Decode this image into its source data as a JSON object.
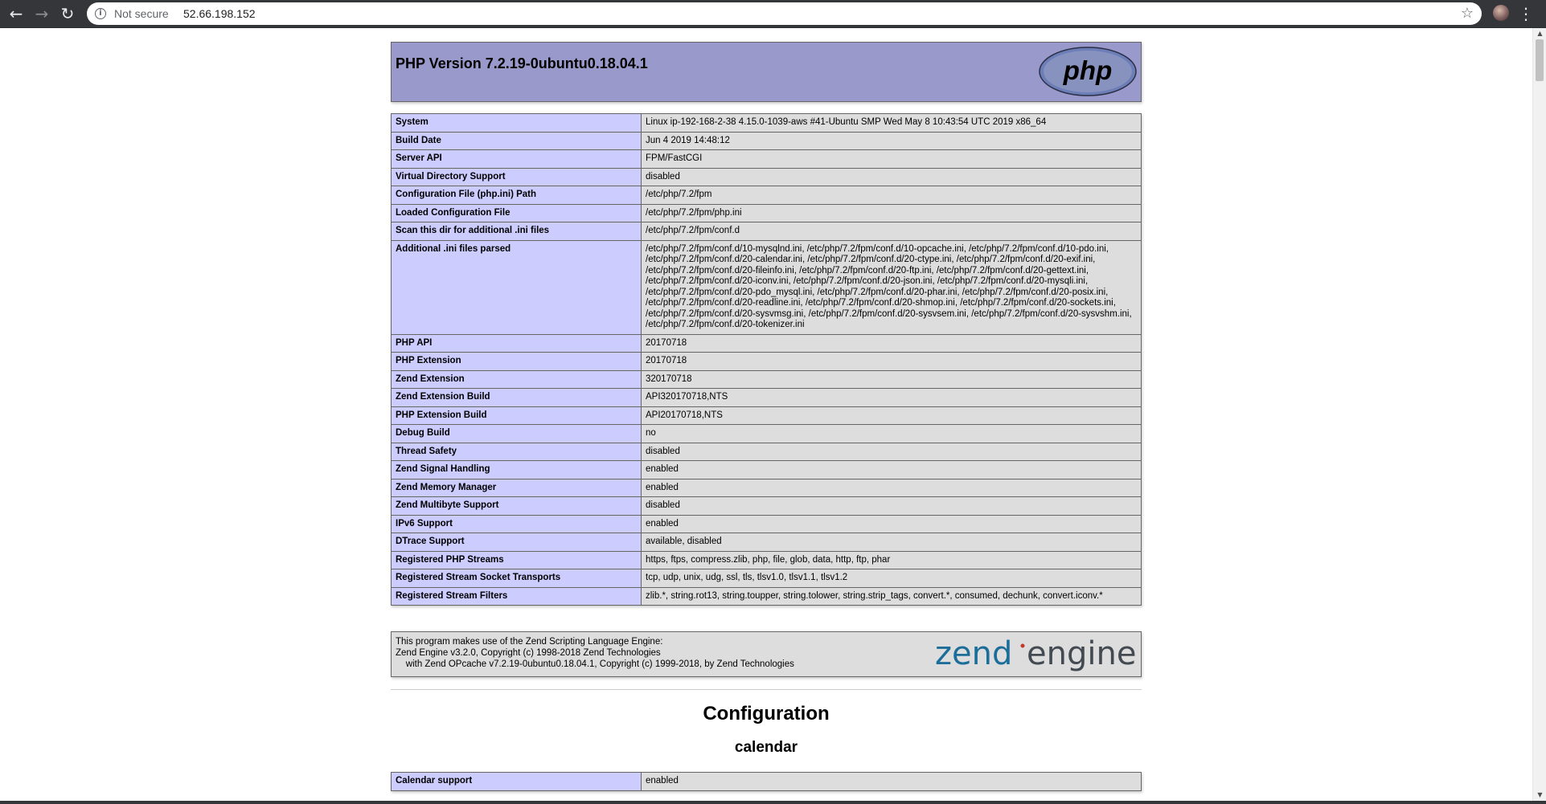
{
  "browser": {
    "security_label": "Not secure",
    "url": "52.66.198.152"
  },
  "header": {
    "title": "PHP Version 7.2.19-0ubuntu0.18.04.1",
    "logo_text": "php"
  },
  "info_table": [
    {
      "key": "System",
      "value": "Linux ip-192-168-2-38 4.15.0-1039-aws #41-Ubuntu SMP Wed May 8 10:43:54 UTC 2019 x86_64"
    },
    {
      "key": "Build Date",
      "value": "Jun 4 2019 14:48:12"
    },
    {
      "key": "Server API",
      "value": "FPM/FastCGI"
    },
    {
      "key": "Virtual Directory Support",
      "value": "disabled"
    },
    {
      "key": "Configuration File (php.ini) Path",
      "value": "/etc/php/7.2/fpm"
    },
    {
      "key": "Loaded Configuration File",
      "value": "/etc/php/7.2/fpm/php.ini"
    },
    {
      "key": "Scan this dir for additional .ini files",
      "value": "/etc/php/7.2/fpm/conf.d"
    },
    {
      "key": "Additional .ini files parsed",
      "value": "/etc/php/7.2/fpm/conf.d/10-mysqlnd.ini, /etc/php/7.2/fpm/conf.d/10-opcache.ini, /etc/php/7.2/fpm/conf.d/10-pdo.ini, /etc/php/7.2/fpm/conf.d/20-calendar.ini, /etc/php/7.2/fpm/conf.d/20-ctype.ini, /etc/php/7.2/fpm/conf.d/20-exif.ini, /etc/php/7.2/fpm/conf.d/20-fileinfo.ini, /etc/php/7.2/fpm/conf.d/20-ftp.ini, /etc/php/7.2/fpm/conf.d/20-gettext.ini, /etc/php/7.2/fpm/conf.d/20-iconv.ini, /etc/php/7.2/fpm/conf.d/20-json.ini, /etc/php/7.2/fpm/conf.d/20-mysqli.ini, /etc/php/7.2/fpm/conf.d/20-pdo_mysql.ini, /etc/php/7.2/fpm/conf.d/20-phar.ini, /etc/php/7.2/fpm/conf.d/20-posix.ini, /etc/php/7.2/fpm/conf.d/20-readline.ini, /etc/php/7.2/fpm/conf.d/20-shmop.ini, /etc/php/7.2/fpm/conf.d/20-sockets.ini, /etc/php/7.2/fpm/conf.d/20-sysvmsg.ini, /etc/php/7.2/fpm/conf.d/20-sysvsem.ini, /etc/php/7.2/fpm/conf.d/20-sysvshm.ini, /etc/php/7.2/fpm/conf.d/20-tokenizer.ini"
    },
    {
      "key": "PHP API",
      "value": "20170718"
    },
    {
      "key": "PHP Extension",
      "value": "20170718"
    },
    {
      "key": "Zend Extension",
      "value": "320170718"
    },
    {
      "key": "Zend Extension Build",
      "value": "API320170718,NTS"
    },
    {
      "key": "PHP Extension Build",
      "value": "API20170718,NTS"
    },
    {
      "key": "Debug Build",
      "value": "no"
    },
    {
      "key": "Thread Safety",
      "value": "disabled"
    },
    {
      "key": "Zend Signal Handling",
      "value": "enabled"
    },
    {
      "key": "Zend Memory Manager",
      "value": "enabled"
    },
    {
      "key": "Zend Multibyte Support",
      "value": "disabled"
    },
    {
      "key": "IPv6 Support",
      "value": "enabled"
    },
    {
      "key": "DTrace Support",
      "value": "available, disabled"
    },
    {
      "key": "Registered PHP Streams",
      "value": "https, ftps, compress.zlib, php, file, glob, data, http, ftp, phar"
    },
    {
      "key": "Registered Stream Socket Transports",
      "value": "tcp, udp, unix, udg, ssl, tls, tlsv1.0, tlsv1.1, tlsv1.2"
    },
    {
      "key": "Registered Stream Filters",
      "value": "zlib.*, string.rot13, string.toupper, string.tolower, string.strip_tags, convert.*, consumed, dechunk, convert.iconv.*"
    }
  ],
  "zend": {
    "line1": "This program makes use of the Zend Scripting Language Engine:",
    "line2": "Zend Engine v3.2.0, Copyright (c) 1998-2018 Zend Technologies",
    "line3": "    with Zend OPcache v7.2.19-0ubuntu0.18.04.1, Copyright (c) 1999-2018, by Zend Technologies",
    "logo_word1": "zend",
    "logo_word2": "engine"
  },
  "configuration": {
    "heading": "Configuration",
    "section": "calendar",
    "rows": [
      {
        "key": "Calendar support",
        "value": "enabled"
      }
    ]
  },
  "colors": {
    "header_bg": "#9999cc",
    "key_bg": "#ccccff",
    "value_bg": "#dddddd"
  }
}
